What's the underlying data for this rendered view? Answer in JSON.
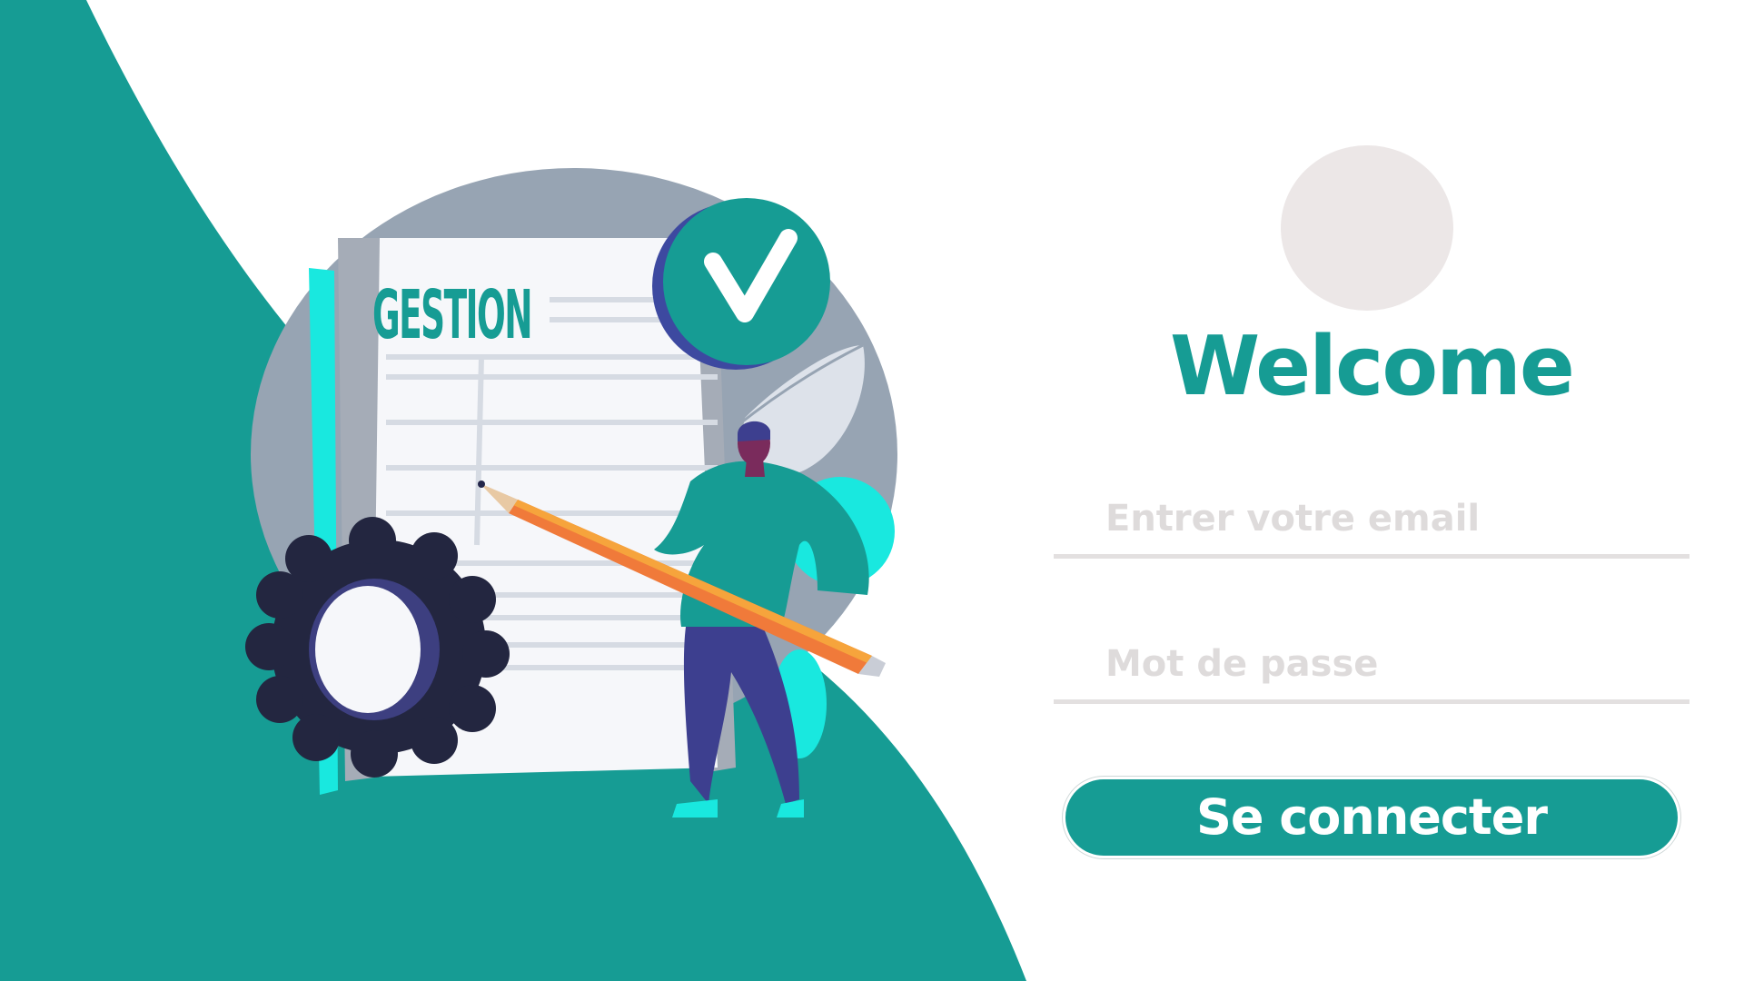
{
  "illustration": {
    "document_title": "GESTION"
  },
  "login": {
    "title": "Welcome",
    "email_placeholder": "Entrer votre email",
    "password_placeholder": "Mot de passe",
    "submit_label": "Se connecter"
  },
  "colors": {
    "teal": "#169c94",
    "cyan": "#16e8e0",
    "background": "#ffffff",
    "avatar": "#ece7e7",
    "placeholder": "#dedbdb",
    "gear": "#232640"
  }
}
